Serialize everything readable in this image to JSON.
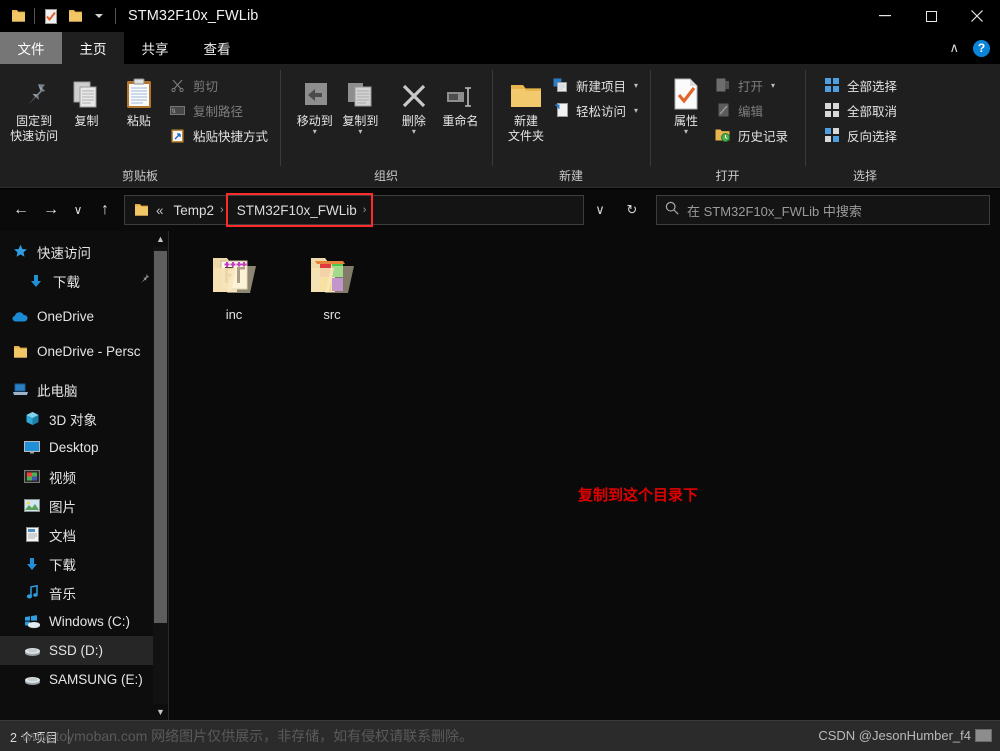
{
  "window": {
    "title": "STM32F10x_FWLib",
    "quick_access": [
      {
        "name": "folder-icon",
        "label": "folder"
      },
      {
        "name": "properties-icon",
        "label": "properties"
      },
      {
        "name": "new-folder-icon",
        "label": "new folder"
      },
      {
        "name": "chevron-down-icon",
        "label": "customize"
      }
    ],
    "controls": {
      "minimize": "—",
      "maximize": "□",
      "close": "✕",
      "collapse_ribbon": "∧",
      "help": "?"
    }
  },
  "tabs": [
    {
      "id": "file",
      "label": "文件"
    },
    {
      "id": "home",
      "label": "主页"
    },
    {
      "id": "share",
      "label": "共享"
    },
    {
      "id": "view",
      "label": "查看"
    }
  ],
  "ribbon": {
    "groups": [
      {
        "id": "clipboard",
        "label": "剪贴板",
        "big_buttons": [
          {
            "id": "pin-to-quick-access",
            "label": "固定到\n快速访问",
            "line1": "固定到",
            "line2": "快速访问"
          },
          {
            "id": "copy",
            "line1": "复制",
            "line2": ""
          },
          {
            "id": "paste",
            "line1": "粘贴",
            "line2": ""
          }
        ],
        "small_buttons": [
          {
            "id": "cut",
            "label": "剪切",
            "dim": true
          },
          {
            "id": "copy-path",
            "label": "复制路径",
            "dim": true
          },
          {
            "id": "paste-shortcut",
            "label": "粘贴快捷方式",
            "dim": false
          }
        ]
      },
      {
        "id": "organize",
        "label": "组织",
        "big_buttons": [
          {
            "id": "move-to",
            "line1": "移动到",
            "line2": "",
            "caret": true
          },
          {
            "id": "copy-to",
            "line1": "复制到",
            "line2": "",
            "caret": true
          },
          {
            "id": "delete",
            "line1": "删除",
            "line2": "",
            "caret": true
          },
          {
            "id": "rename",
            "line1": "重命名",
            "line2": ""
          }
        ],
        "small_buttons": []
      },
      {
        "id": "new",
        "label": "新建",
        "big_buttons": [
          {
            "id": "new-folder",
            "line1": "新建",
            "line2": "文件夹"
          }
        ],
        "small_buttons": [
          {
            "id": "new-item",
            "label": "新建项目",
            "caret": true
          },
          {
            "id": "easy-access",
            "label": "轻松访问",
            "caret": true
          }
        ]
      },
      {
        "id": "open",
        "label": "打开",
        "big_buttons": [
          {
            "id": "properties",
            "line1": "属性",
            "line2": "",
            "caret": true
          }
        ],
        "small_buttons": [
          {
            "id": "open",
            "label": "打开",
            "dim": true,
            "caret": true
          },
          {
            "id": "edit",
            "label": "编辑",
            "dim": true
          },
          {
            "id": "history",
            "label": "历史记录",
            "dim": false
          }
        ]
      },
      {
        "id": "select",
        "label": "选择",
        "big_buttons": [],
        "small_buttons": [
          {
            "id": "select-all",
            "label": "全部选择"
          },
          {
            "id": "select-none",
            "label": "全部取消"
          },
          {
            "id": "invert-selection",
            "label": "反向选择"
          }
        ]
      }
    ]
  },
  "address_bar": {
    "back": "←",
    "forward": "→",
    "recent": "∨",
    "up": "↑",
    "breadcrumbs": [
      {
        "id": "overflow",
        "label": "«",
        "highlight": false
      },
      {
        "id": "temp2",
        "label": "Temp2",
        "highlight": false
      },
      {
        "id": "stm32f10x-fwlib",
        "label": "STM32F10x_FWLib",
        "highlight": true
      }
    ],
    "dropdown": "∨",
    "refresh": "↻",
    "search_placeholder": "在 STM32F10x_FWLib 中搜索"
  },
  "nav_pane": {
    "items": [
      {
        "id": "quick-access",
        "label": "快速访问",
        "icon": "star-icon",
        "indent": 0,
        "selected": false,
        "pinned": false
      },
      {
        "id": "downloads-quick",
        "label": "下载",
        "icon": "download-icon",
        "indent": 1,
        "selected": false,
        "pinned": true
      },
      {
        "id": "onedrive",
        "label": "OneDrive",
        "icon": "cloud-icon",
        "indent": 0,
        "selected": false,
        "pinned": false
      },
      {
        "id": "onedrive-personal",
        "label": "OneDrive - Persc",
        "icon": "folder-icon",
        "indent": 0,
        "selected": false,
        "pinned": false
      },
      {
        "id": "this-pc",
        "label": "此电脑",
        "icon": "pc-icon",
        "indent": 0,
        "selected": false,
        "pinned": false
      },
      {
        "id": "3d-objects",
        "label": "3D 对象",
        "icon": "cube-icon",
        "indent": 2,
        "selected": false,
        "pinned": false
      },
      {
        "id": "desktop",
        "label": "Desktop",
        "icon": "desktop-icon",
        "indent": 2,
        "selected": false,
        "pinned": false
      },
      {
        "id": "videos",
        "label": "视频",
        "icon": "video-icon",
        "indent": 2,
        "selected": false,
        "pinned": false
      },
      {
        "id": "pictures",
        "label": "图片",
        "icon": "picture-icon",
        "indent": 2,
        "selected": false,
        "pinned": false
      },
      {
        "id": "documents",
        "label": "文档",
        "icon": "document-icon",
        "indent": 2,
        "selected": false,
        "pinned": false
      },
      {
        "id": "downloads",
        "label": "下载",
        "icon": "download-icon",
        "indent": 2,
        "selected": false,
        "pinned": false
      },
      {
        "id": "music",
        "label": "音乐",
        "icon": "music-icon",
        "indent": 2,
        "selected": false,
        "pinned": false
      },
      {
        "id": "windows-c",
        "label": "Windows (C:)",
        "icon": "windows-drive-icon",
        "indent": 2,
        "selected": false,
        "pinned": false
      },
      {
        "id": "ssd-d",
        "label": "SSD (D:)",
        "icon": "drive-icon",
        "indent": 2,
        "selected": true,
        "pinned": false
      },
      {
        "id": "samsung-e",
        "label": "SAMSUNG (E:)",
        "icon": "drive-icon",
        "indent": 2,
        "selected": false,
        "pinned": false
      }
    ]
  },
  "files": {
    "items": [
      {
        "id": "inc",
        "name": "inc",
        "type": "folder-special"
      },
      {
        "id": "src",
        "name": "src",
        "type": "folder-special"
      }
    ],
    "annotation": "复制到这个目录下"
  },
  "status_bar": {
    "item_count": "2 个项目",
    "watermark": "www.toymoban.com 网络图片仅供展示，非存储，如有侵权请联系删除。",
    "csdn": "CSDN @JesonHumber_f4"
  },
  "colors": {
    "accent_blue": "#0a84d8",
    "annotation_red": "#e00000",
    "highlight_red": "#ff2b2b",
    "folder_yellow": "#f5c96b",
    "background": "#000000",
    "ribbon_bg": "#1f1f1f",
    "status_bg": "#2b2b2b"
  }
}
